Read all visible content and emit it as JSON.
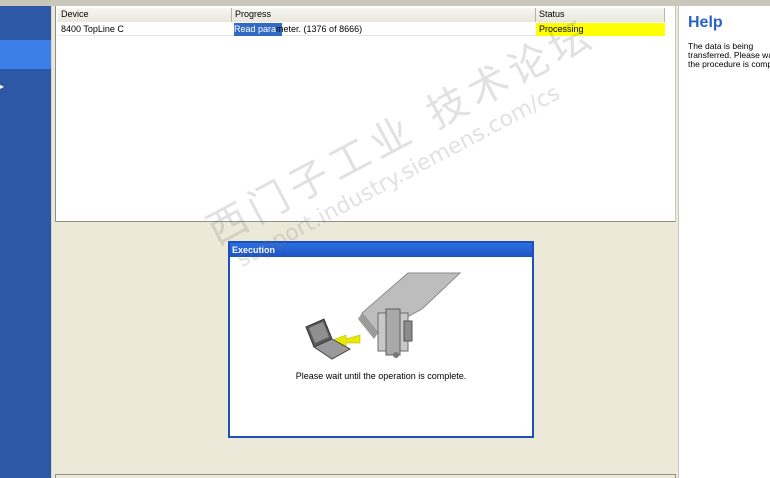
{
  "list": {
    "columns": [
      "Device",
      "Progress",
      "Status"
    ],
    "rows": [
      {
        "device": "8400 TopLine C",
        "progress_text_highlighted": "Read para",
        "progress_text_rest": "meter. (1376 of 8666)",
        "progress_fraction": 0.159,
        "status": "Processing"
      }
    ]
  },
  "dialog": {
    "title": "Execution",
    "message": "Please wait until the operation is complete."
  },
  "help": {
    "title": "Help",
    "text": "The data is being transferred. Please wait until the procedure is complete."
  },
  "watermark": {
    "line1": "西门子工业  技术论坛",
    "line2": "support.industry.siemens.com/cs"
  },
  "colors": {
    "nav_background": "#2d58a6",
    "nav_selected": "#3d7fe8",
    "status_processing": "#ffff00",
    "progress_fill": "#316ac5",
    "help_title": "#2a63c7"
  },
  "icons": {
    "dialog_illustration": "laptop-to-device-transfer-icon"
  }
}
